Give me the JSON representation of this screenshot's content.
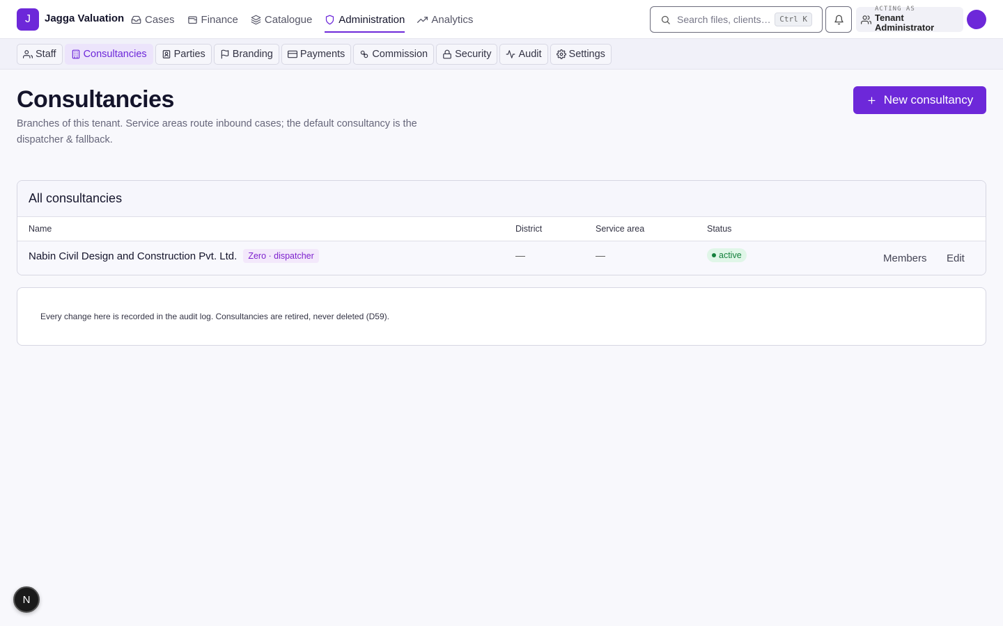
{
  "app": {
    "logo_letter": "J",
    "name": "Jagga Valuation"
  },
  "nav": {
    "items": [
      {
        "label": "Cases",
        "icon": "inbox-icon"
      },
      {
        "label": "Finance",
        "icon": "wallet-icon"
      },
      {
        "label": "Catalogue",
        "icon": "layers-icon"
      },
      {
        "label": "Administration",
        "icon": "shield-icon",
        "active": true
      },
      {
        "label": "Analytics",
        "icon": "trending-up-icon"
      }
    ]
  },
  "search": {
    "placeholder": "Search files, clients…",
    "shortcut": "Ctrl K"
  },
  "acting": {
    "label": "ACTING AS",
    "role": "Tenant Administrator"
  },
  "subnav": {
    "tabs": [
      {
        "label": "Staff",
        "icon": "users-icon"
      },
      {
        "label": "Consultancies",
        "icon": "building-icon",
        "active": true
      },
      {
        "label": "Parties",
        "icon": "id-badge-icon"
      },
      {
        "label": "Branding",
        "icon": "flag-icon"
      },
      {
        "label": "Payments",
        "icon": "credit-card-icon"
      },
      {
        "label": "Commission",
        "icon": "percent-icon"
      },
      {
        "label": "Security",
        "icon": "lock-icon"
      },
      {
        "label": "Audit",
        "icon": "activity-icon"
      },
      {
        "label": "Settings",
        "icon": "gear-icon"
      }
    ]
  },
  "page": {
    "title": "Consultancies",
    "description": "Branches of this tenant. Service areas route inbound cases; the default consultancy is the dispatcher & fallback.",
    "new_button": "New consultancy"
  },
  "table": {
    "title": "All consultancies",
    "columns": [
      "Name",
      "District",
      "Service area",
      "Status"
    ],
    "rows": [
      {
        "name": "Nabin Civil Design and Construction Pvt. Ltd.",
        "tag": "Zero · dispatcher",
        "district": "—",
        "service_area": "—",
        "status": "active",
        "actions": [
          "Members",
          "Edit"
        ]
      }
    ]
  },
  "note": "Every change here is recorded in the audit log. Consultancies are retired, never deleted (D59).",
  "fab": "N",
  "colors": {
    "accent": "#6d28d9",
    "status_active": "#15803d",
    "status_active_bg": "#e0f6e8"
  }
}
